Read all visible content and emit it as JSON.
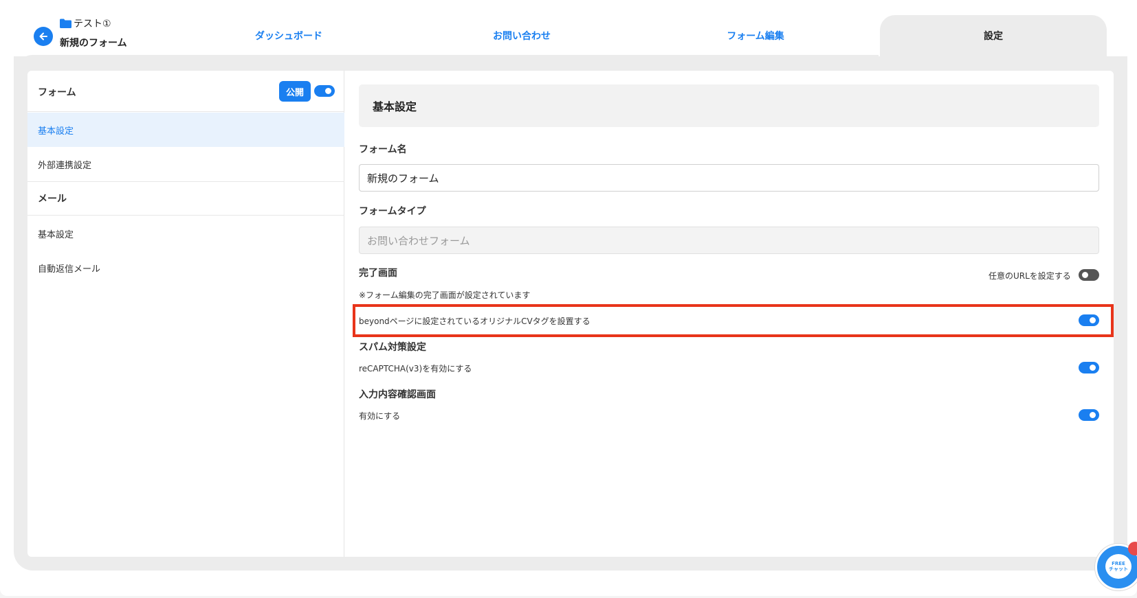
{
  "header": {
    "project_name": "テスト①",
    "form_title": "新規のフォーム",
    "tabs": [
      {
        "label": "ダッシュボード"
      },
      {
        "label": "お問い合わせ"
      },
      {
        "label": "フォーム編集"
      },
      {
        "label": "設定"
      }
    ]
  },
  "sidebar": {
    "form_section": "フォーム",
    "publish_label": "公開",
    "items": [
      {
        "label": "基本設定"
      },
      {
        "label": "外部連携設定"
      },
      {
        "label": "メール"
      },
      {
        "label": "基本設定"
      },
      {
        "label": "自動返信メール"
      }
    ]
  },
  "main": {
    "section_title": "基本設定",
    "form_name_label": "フォーム名",
    "form_name_value": "新規のフォーム",
    "form_type_label": "フォームタイプ",
    "form_type_value": "お問い合わせフォーム",
    "completion_label": "完了画面",
    "custom_url_label": "任意のURLを設定する",
    "completion_note": "※フォーム編集の完了画面が設定されています",
    "cv_tag_label": "beyondページに設定されているオリジナルCVタグを設置する",
    "spam_label": "スパム対策設定",
    "recaptcha_label": "reCAPTCHA(v3)を有効にする",
    "confirm_label": "入力内容確認画面",
    "confirm_enable_label": "有効にする"
  },
  "chat": {
    "line1": "FREE",
    "line2": "チャット"
  },
  "colors": {
    "accent": "#1a7ff0",
    "highlight": "#e8341a"
  }
}
